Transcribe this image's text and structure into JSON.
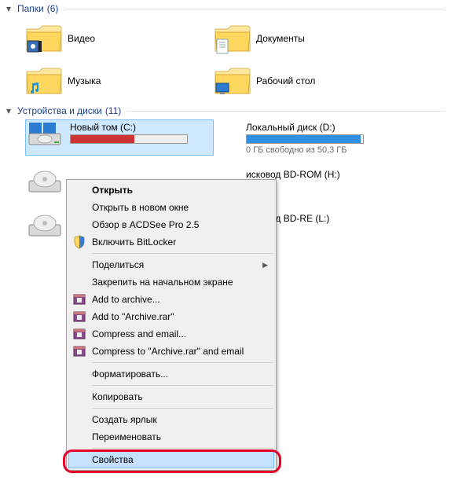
{
  "sections": {
    "folders": {
      "title": "Папки",
      "count": "(6)"
    },
    "devices": {
      "title": "Устройства и диски",
      "count": "(11)"
    }
  },
  "folders": {
    "video": "Видео",
    "documents": "Документы",
    "music": "Музыка",
    "desktop": "Рабочий стол"
  },
  "drives": {
    "c": {
      "label": "Новый том (C:)"
    },
    "d": {
      "label": "Локальный диск (D:)",
      "free": "0 ГБ свободно из 50,3 ГБ",
      "fillPct": 98,
      "fillColor": "#2f8fe0"
    },
    "h": {
      "label": "исковод BD-ROM (H:)"
    },
    "l": {
      "label": "исковод BD-RE (L:)"
    }
  },
  "ctx": {
    "open": "Открыть",
    "openNew": "Открыть в новом окне",
    "acdsee": "Обзор в ACDSee Pro 2.5",
    "bitlocker": "Включить BitLocker",
    "share": "Поделиться",
    "pin": "Закрепить на начальном экране",
    "addArchive": "Add to archive...",
    "addArchiveRar": "Add to \"Archive.rar\"",
    "compressEmail": "Compress and email...",
    "compressRarEmail": "Compress to \"Archive.rar\" and email",
    "format": "Форматировать...",
    "copy": "Копировать",
    "shortcut": "Создать ярлык",
    "rename": "Переименовать",
    "properties": "Свойства"
  }
}
